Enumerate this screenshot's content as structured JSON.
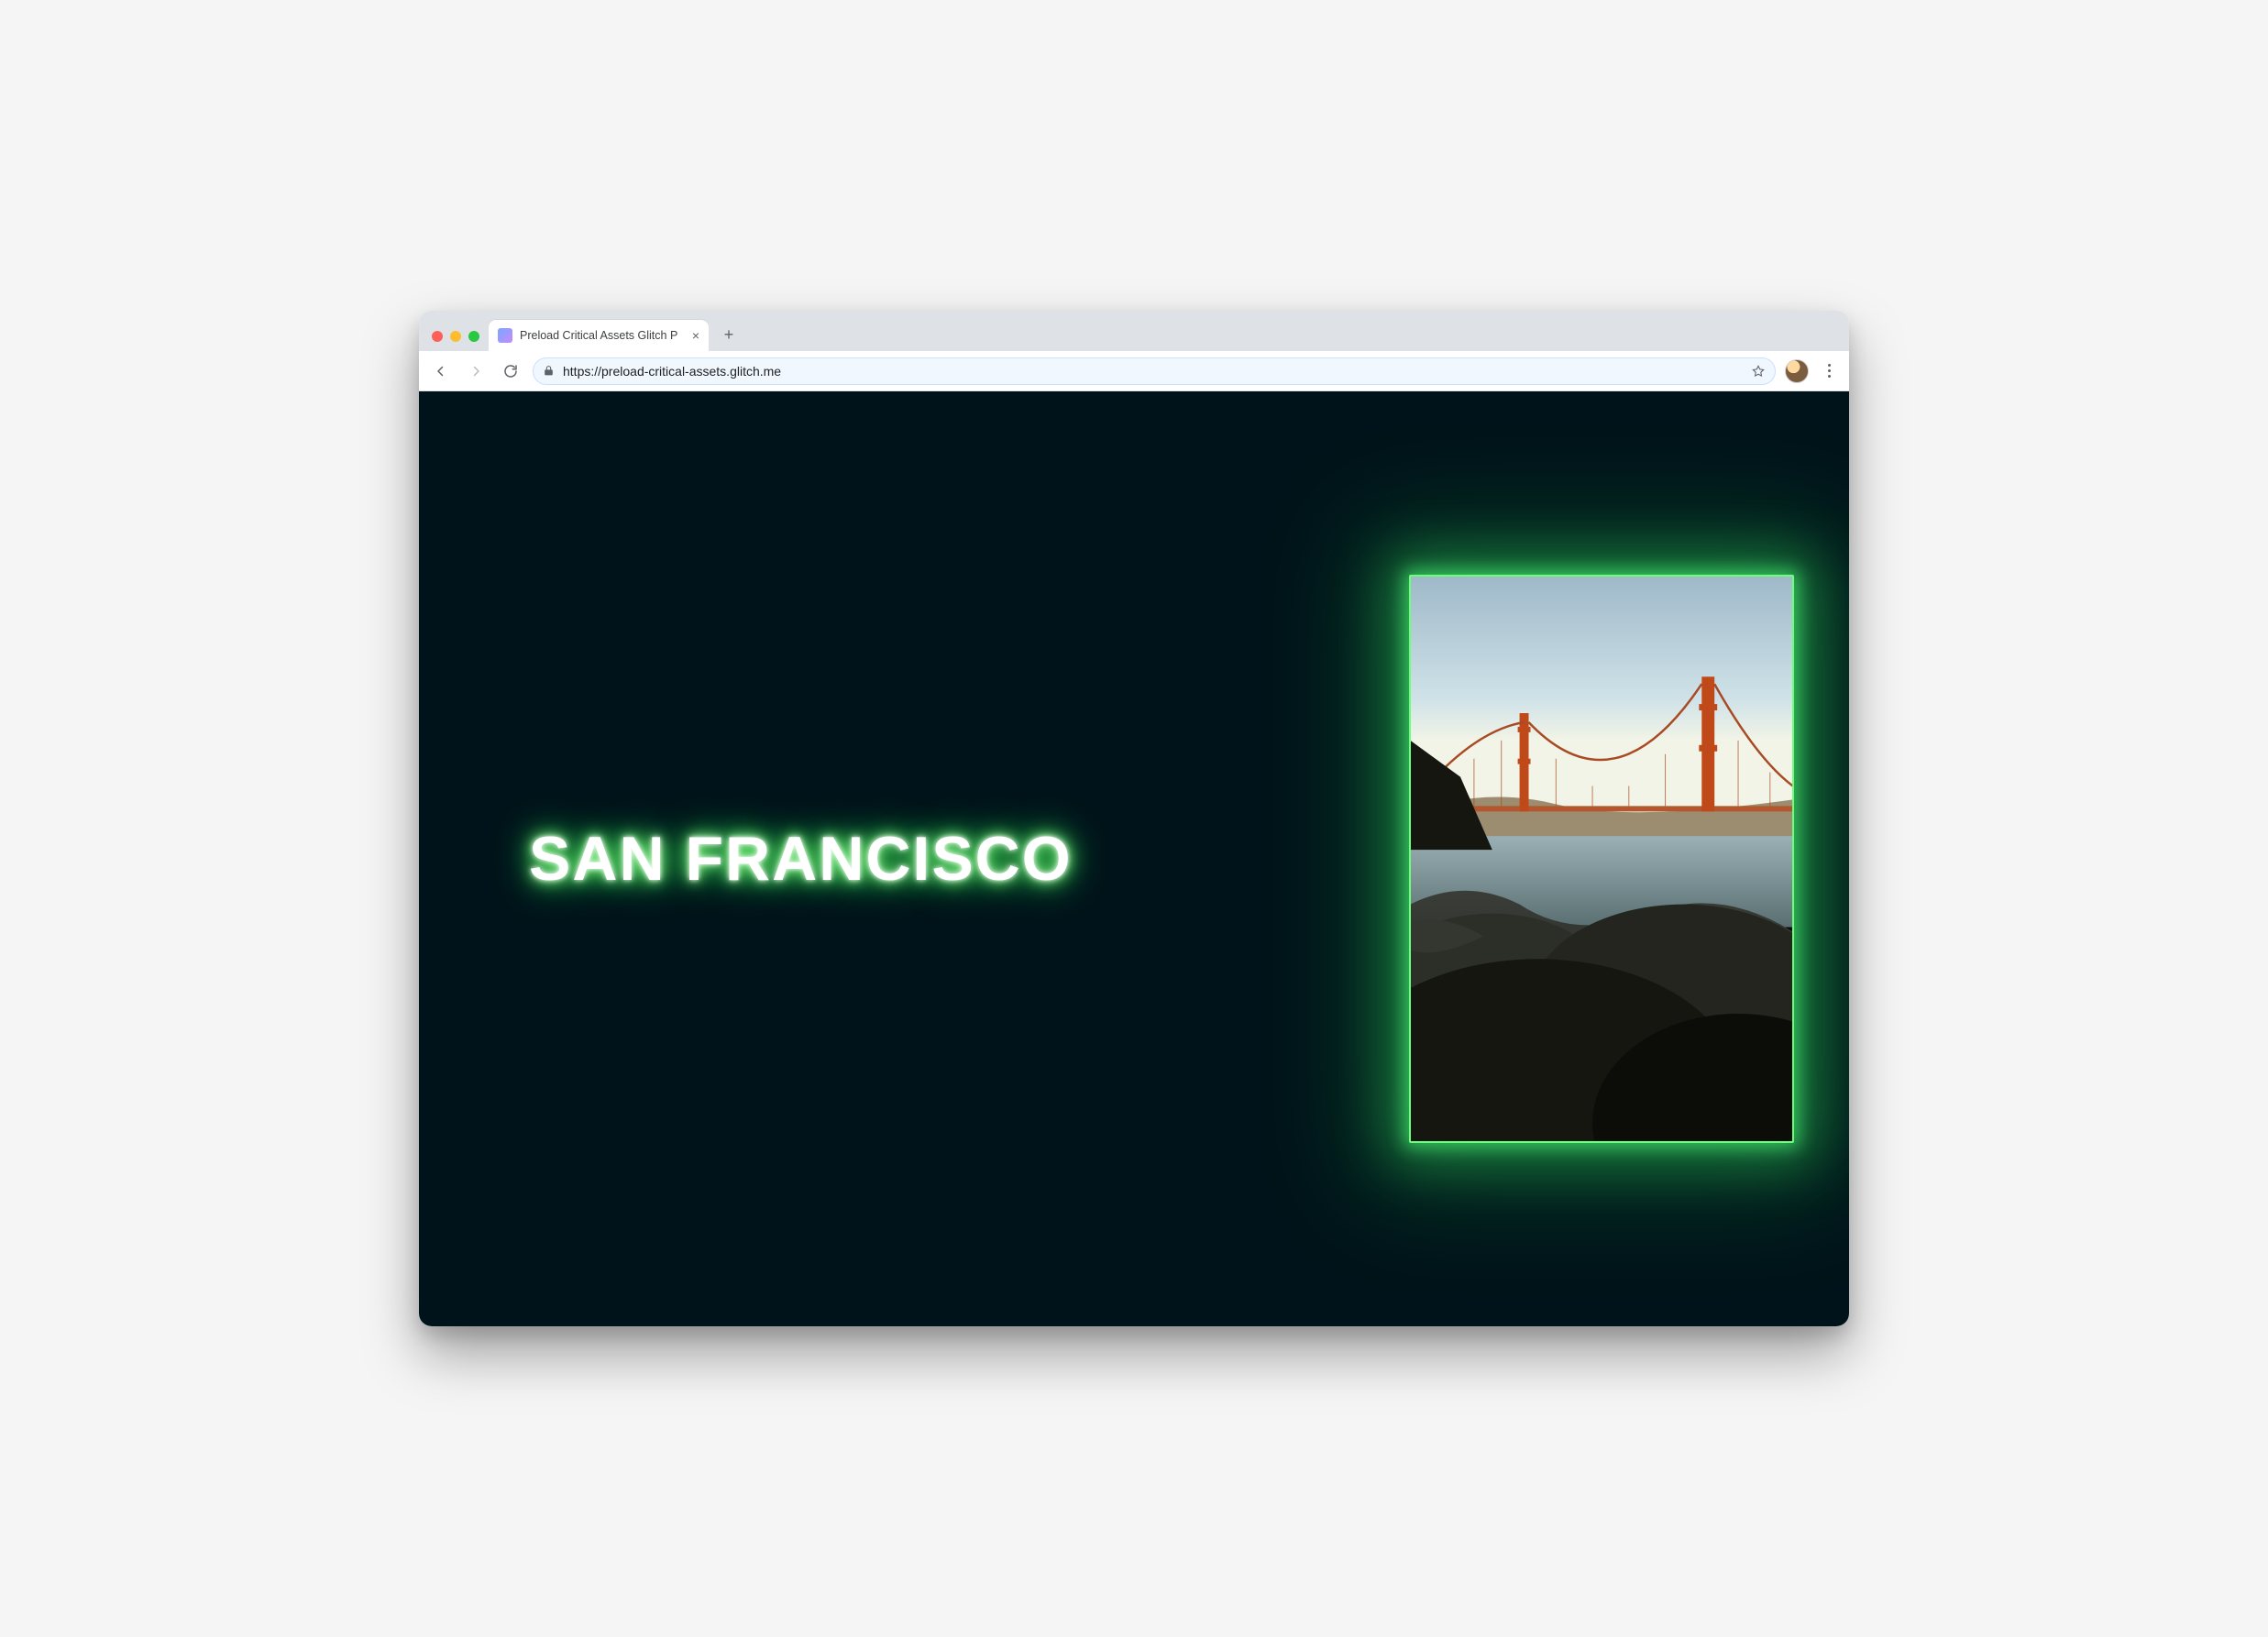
{
  "browser": {
    "tab": {
      "title": "Preload Critical Assets Glitch P",
      "favicon_name": "glitch-favicon"
    },
    "url": "https://preload-critical-assets.glitch.me",
    "nav": {
      "back_enabled": true,
      "forward_enabled": false
    }
  },
  "page": {
    "headline": "SAN FRANCISCO",
    "image_alt": "Golden Gate Bridge seen from rocky shore",
    "glow_color": "#4bff4b",
    "background_color": "#00131a"
  }
}
